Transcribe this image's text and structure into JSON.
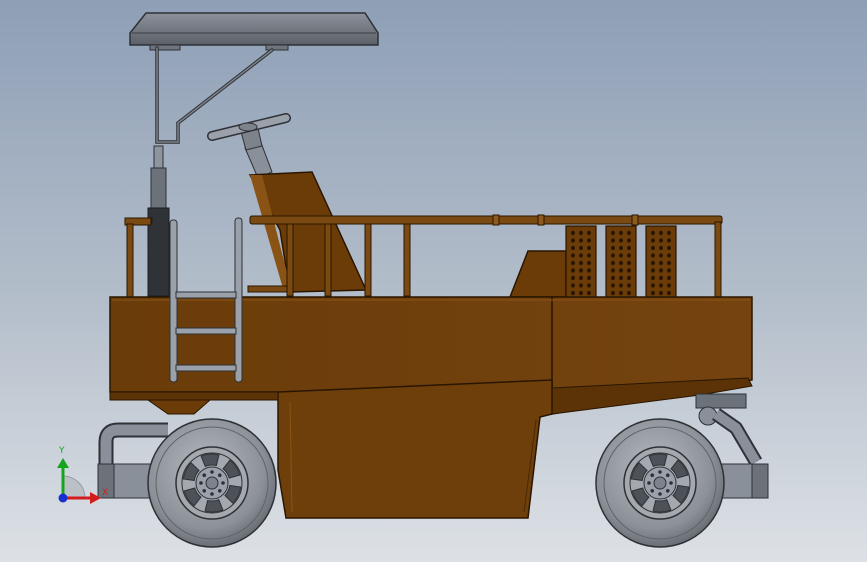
{
  "model": {
    "body_color": "#6e3f0a",
    "body_shade": "#5c3306",
    "rail_color": "#7a4a12",
    "metal_color": "#9aa1aa",
    "metal_dark": "#5f666f",
    "tire_color": "#8b9097"
  },
  "triad": {
    "y_label": "Y",
    "x_label": "X",
    "y_color": "#16a31e",
    "x_color": "#d41c1c",
    "z_color": "#1a2fd0"
  }
}
